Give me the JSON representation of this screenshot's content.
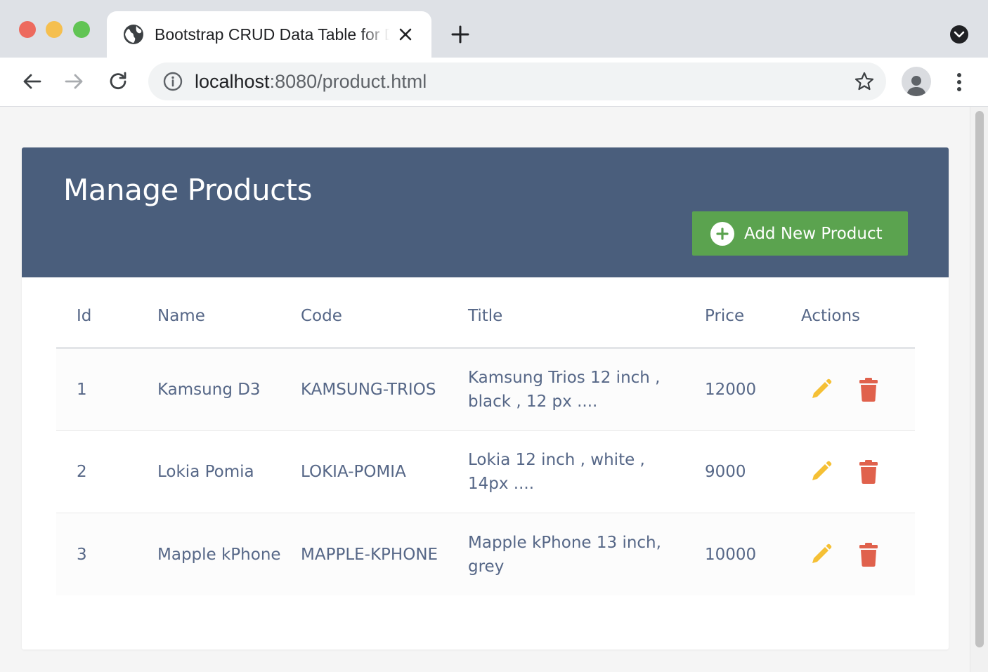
{
  "browser": {
    "tab_title": "Bootstrap CRUD Data Table for Database with Modal Form",
    "url_host": "localhost",
    "url_rest": ":8080/product.html"
  },
  "page": {
    "title": "Manage Products",
    "add_button_label": "Add New Product"
  },
  "table": {
    "headers": {
      "id": "Id",
      "name": "Name",
      "code": "Code",
      "title": "Title",
      "price": "Price",
      "actions": "Actions"
    },
    "rows": [
      {
        "id": "1",
        "name": "Kamsung D3",
        "code": "KAMSUNG-TRIOS",
        "title": "Kamsung Trios 12 inch , black , 12 px ....",
        "price": "12000"
      },
      {
        "id": "2",
        "name": "Lokia Pomia",
        "code": "LOKIA-POMIA",
        "title": "Lokia 12 inch , white , 14px ....",
        "price": "9000"
      },
      {
        "id": "3",
        "name": "Mapple kPhone",
        "code": "MAPPLE-KPHONE",
        "title": "Mapple kPhone 13 inch, grey",
        "price": "10000"
      }
    ]
  },
  "colors": {
    "header_bg": "#4a5e7c",
    "add_button_bg": "#5ba34f",
    "edit_icon": "#f5c035",
    "delete_icon": "#e0614c",
    "text": "#566787"
  },
  "icons": {
    "tab": "globe-icon",
    "add": "plus-circle-icon",
    "edit": "pencil-icon",
    "delete": "trash-icon"
  }
}
